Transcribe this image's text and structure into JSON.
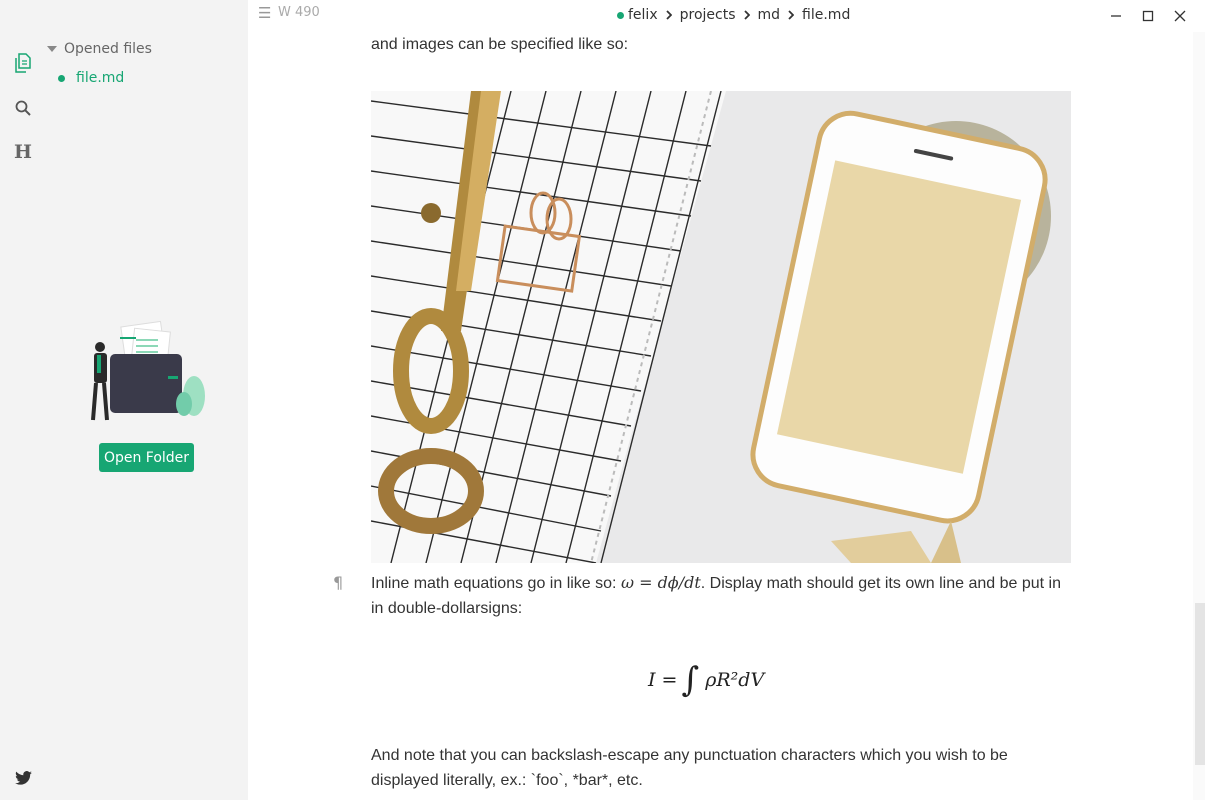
{
  "sidebar": {
    "section_title": "Opened files",
    "opened_files": [
      "file.md"
    ],
    "open_folder_label": "Open Folder",
    "toc_glyph": "H",
    "icons": [
      "files-icon",
      "search-icon",
      "heading-icon",
      "twitter-icon"
    ]
  },
  "titlebar": {
    "word_count": "W 490",
    "breadcrumb": [
      "felix",
      "projects",
      "md",
      "file.md"
    ]
  },
  "content": {
    "para_images": "and images can be specified like so:",
    "para_math_before": "Inline math equations go in like so: ",
    "inline_math": "ω = dϕ/dt",
    "para_math_after": ". Display math should get its own line and be put in in double-dollarsigns:",
    "display_math": {
      "lhs": "I =",
      "integral": "∫",
      "rhs": "ρR²dV"
    },
    "para_escape": "And note that you can backslash-escape any punctuation characters which you wish to be displayed literally, ex.: `foo`, *bar*, etc."
  },
  "colors": {
    "accent": "#17a673",
    "sidebar_bg": "#f3f3f3",
    "text": "#333333"
  }
}
